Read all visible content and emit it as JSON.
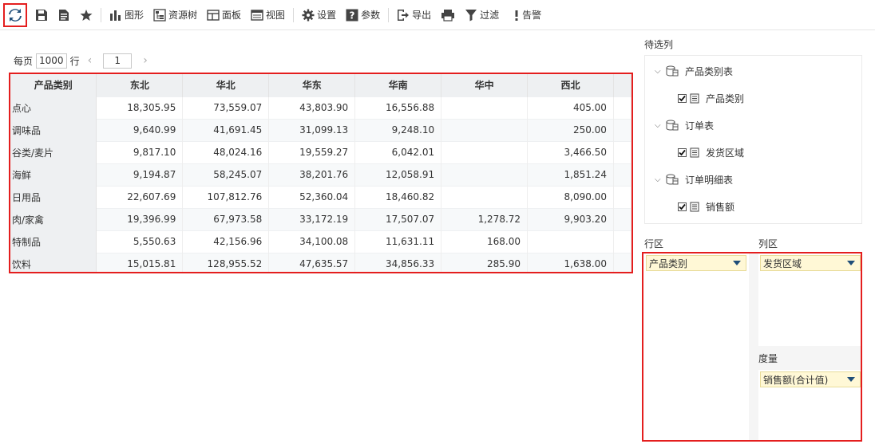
{
  "toolbar": {
    "chart_label": "图形",
    "resource_tree_label": "资源树",
    "panel_label": "面板",
    "view_label": "视图",
    "settings_label": "设置",
    "params_label": "参数",
    "export_label": "导出",
    "filter_label": "过滤",
    "alert_label": "告警"
  },
  "pager": {
    "per_page_label": "每页",
    "rows_per_page": "1000",
    "rows_unit": "行",
    "current_page": "1"
  },
  "grid": {
    "corner_header": "产品类别",
    "columns": [
      "东北",
      "华北",
      "华东",
      "华南",
      "华中",
      "西北"
    ],
    "rows": [
      {
        "label": "点心",
        "values": [
          "18,305.95",
          "73,559.07",
          "43,803.90",
          "16,556.88",
          "",
          "405.00"
        ]
      },
      {
        "label": "调味品",
        "values": [
          "9,640.99",
          "41,691.45",
          "31,099.13",
          "9,248.10",
          "",
          "250.00"
        ]
      },
      {
        "label": "谷类/麦片",
        "values": [
          "9,817.10",
          "48,024.16",
          "19,559.27",
          "6,042.01",
          "",
          "3,466.50"
        ]
      },
      {
        "label": "海鲜",
        "values": [
          "9,194.87",
          "58,245.07",
          "38,201.76",
          "12,058.91",
          "",
          "1,851.24"
        ]
      },
      {
        "label": "日用品",
        "values": [
          "22,607.69",
          "107,812.76",
          "52,360.04",
          "18,460.82",
          "",
          "8,090.00"
        ]
      },
      {
        "label": "肉/家禽",
        "values": [
          "19,396.99",
          "67,973.58",
          "33,172.19",
          "17,507.07",
          "1,278.72",
          "9,903.20"
        ]
      },
      {
        "label": "特制品",
        "values": [
          "5,550.63",
          "42,156.96",
          "34,100.08",
          "11,631.11",
          "168.00",
          ""
        ]
      },
      {
        "label": "饮料",
        "values": [
          "15,015.81",
          "128,955.52",
          "47,635.57",
          "34,856.33",
          "285.90",
          "1,638.00"
        ]
      }
    ]
  },
  "fields_panel": {
    "title": "待选列",
    "tables": [
      {
        "name": "产品类别表",
        "field": "产品类别"
      },
      {
        "name": "订单表",
        "field": "发货区域"
      },
      {
        "name": "订单明细表",
        "field": "销售额"
      }
    ]
  },
  "zones": {
    "row_zone_title": "行区",
    "col_zone_title": "列区",
    "measure_zone_title": "度量",
    "row_field": "产品类别",
    "col_field": "发货区域",
    "measure_field": "销售额(合计值)"
  },
  "colors": {
    "highlight_border": "#e41e1e",
    "icon_dark": "#444444",
    "refresh_blue": "#1f4e79",
    "pill_bg": "#fff8d6"
  }
}
